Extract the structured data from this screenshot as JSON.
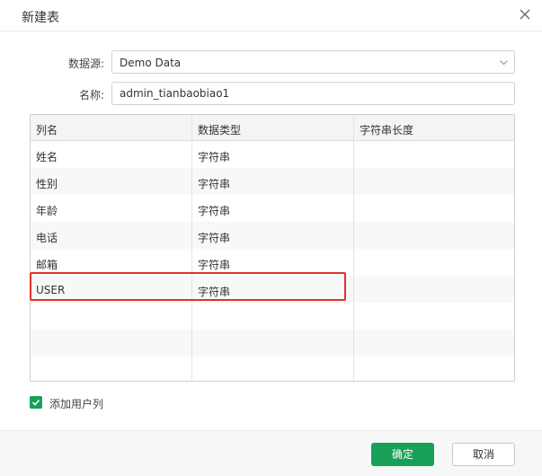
{
  "dialog": {
    "title": "新建表"
  },
  "form": {
    "datasource_label": "数据源:",
    "datasource_value": "Demo Data",
    "name_label": "名称:",
    "name_value": "admin_tianbaobiao1"
  },
  "grid": {
    "columns": [
      "列名",
      "数据类型",
      "字符串长度"
    ],
    "rows": [
      {
        "name": "姓名",
        "type": "字符串",
        "length": ""
      },
      {
        "name": "性别",
        "type": "字符串",
        "length": ""
      },
      {
        "name": "年龄",
        "type": "字符串",
        "length": ""
      },
      {
        "name": "电话",
        "type": "字符串",
        "length": ""
      },
      {
        "name": "邮箱",
        "type": "字符串",
        "length": ""
      },
      {
        "name": "USER",
        "type": "字符串",
        "length": ""
      }
    ]
  },
  "options": {
    "add_user_column_label": "添加用户列",
    "add_user_column_checked": true
  },
  "footer": {
    "ok_label": "确定",
    "cancel_label": "取消"
  },
  "colors": {
    "accent": "#18a058",
    "highlight": "#e1302b"
  },
  "icons": [
    "close-icon",
    "chevron-down-icon",
    "check-icon"
  ]
}
